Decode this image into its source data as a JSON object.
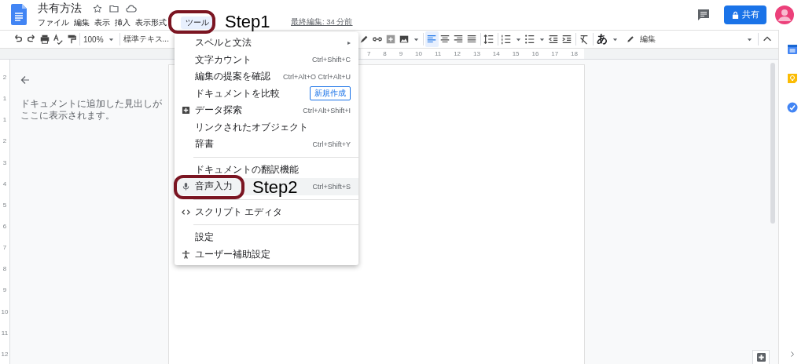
{
  "document": {
    "title": "共有方法",
    "last_edit": "最終編集: 34 分前"
  },
  "menubar": [
    {
      "label": "ファイル",
      "selected": false
    },
    {
      "label": "編集",
      "selected": false
    },
    {
      "label": "表示",
      "selected": false
    },
    {
      "label": "挿入",
      "selected": false
    },
    {
      "label": "表示形式",
      "selected": false
    },
    {
      "label": "ツール",
      "selected": true
    }
  ],
  "share_button": {
    "label": "共有"
  },
  "toolbar": {
    "zoom": "100%",
    "style": "標準テキス...",
    "input_tool": "あ",
    "mode": "編集",
    "alignments": [
      {
        "kind": "left",
        "selected": true
      },
      {
        "kind": "center",
        "selected": false
      },
      {
        "kind": "right",
        "selected": false
      },
      {
        "kind": "justify",
        "selected": false
      }
    ]
  },
  "top_ruler": [
    "7",
    "8",
    "9",
    "10",
    "11",
    "12",
    "13",
    "14",
    "15",
    "16",
    "17",
    "18"
  ],
  "left_ruler": [
    "2",
    "1",
    "1",
    "2",
    "3",
    "4",
    "5",
    "6",
    "7",
    "8",
    "9",
    "10",
    "11",
    "12"
  ],
  "outline_panel": {
    "hint": "ドキュメントに追加した見出しがここに表示されます。"
  },
  "tools_menu": [
    {
      "kind": "item",
      "label": "スペルと文法",
      "submenu": "▸",
      "highlighted": false
    },
    {
      "kind": "item",
      "label": "文字カウント",
      "shortcut": "Ctrl+Shift+C",
      "highlighted": false
    },
    {
      "kind": "item",
      "label": "編集の提案を確認",
      "shortcut": "Ctrl+Alt+O Ctrl+Alt+U",
      "highlighted": false
    },
    {
      "kind": "item",
      "label": "ドキュメントを比較",
      "badge": "新規作成",
      "highlighted": false
    },
    {
      "kind": "item",
      "label": "データ探索",
      "shortcut": "Ctrl+Alt+Shift+I",
      "highlighted": false
    },
    {
      "kind": "item",
      "label": "リンクされたオブジェクト",
      "highlighted": false
    },
    {
      "kind": "item",
      "label": "辞書",
      "shortcut": "Ctrl+Shift+Y",
      "highlighted": false
    },
    {
      "kind": "separator"
    },
    {
      "kind": "item",
      "label": "ドキュメントの翻訳機能",
      "highlighted": false
    },
    {
      "kind": "item",
      "label": "音声入力",
      "shortcut": "Ctrl+Shift+S",
      "highlighted": true
    },
    {
      "kind": "separator"
    },
    {
      "kind": "item",
      "label": "スクリプト エディタ",
      "highlighted": false
    },
    {
      "kind": "separator"
    },
    {
      "kind": "item",
      "label": "設定",
      "highlighted": false
    },
    {
      "kind": "item",
      "label": "ユーザー補助設定",
      "highlighted": false
    }
  ],
  "annotations": [
    {
      "label": "Step1"
    },
    {
      "label": "Step2"
    }
  ]
}
